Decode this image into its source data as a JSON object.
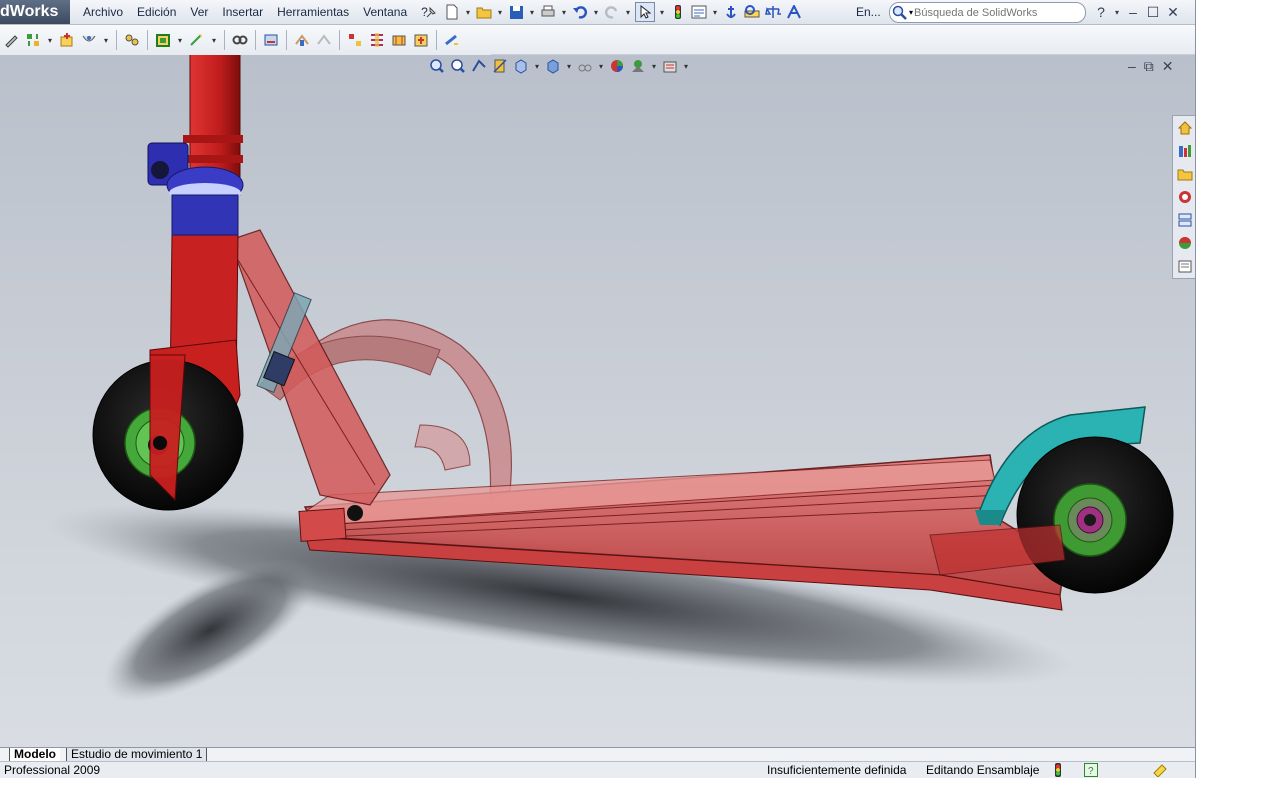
{
  "app": {
    "title_fragment": "dWorks"
  },
  "menu": {
    "items": [
      "Archivo",
      "Edición",
      "Ver",
      "Insertar",
      "Herramientas",
      "Ventana",
      "?"
    ]
  },
  "quick_access": {
    "overflow_label": "En..."
  },
  "search": {
    "placeholder": "Búsqueda de SolidWorks"
  },
  "window_controls": {
    "help": "?",
    "minimize": "–",
    "maximize": "☐",
    "close": "✕"
  },
  "tabs": [
    {
      "label": "Modelo",
      "active": true
    },
    {
      "label": "Estudio de movimiento 1",
      "active": false
    }
  ],
  "status": {
    "product": "Professional 2009",
    "definition": "Insuficientemente definida",
    "mode": "Editando Ensamblaje"
  },
  "colors": {
    "scooter_body": "#d43a3a",
    "scooter_stem": "#cc1f1f",
    "clamp": "#2d2fb0",
    "fender": "#2bb3b3",
    "wheel_tire": "#0d0d0d",
    "wheel_hub": "#3faa2c",
    "viewport_bg": "#c3c8d0"
  },
  "icons": {
    "toolbar": [
      "pencil-icon",
      "smart-mates-icon",
      "insert-component-icon",
      "mate-icon",
      "linear-pattern-icon",
      "move-component-icon",
      "hide-show-icon",
      "assembly-features-icon",
      "reference-geometry-icon",
      "new-motion-study-icon",
      "bill-of-materials-icon",
      "exploded-view-icon",
      "explode-line-icon",
      "interference-icon",
      "clearance-icon",
      "instant3d-icon"
    ],
    "heads_up": [
      "zoom-to-fit-icon",
      "zoom-area-icon",
      "previous-view-icon",
      "section-view-icon",
      "view-orientation-icon",
      "display-style-icon",
      "hide-show-items-icon",
      "appearance-icon",
      "scene-icon",
      "view-settings-icon"
    ],
    "task_pane": [
      "home-icon",
      "design-library-icon",
      "file-explorer-icon",
      "search-icon",
      "view-palette-icon",
      "appearances-icon",
      "custom-properties-icon"
    ]
  }
}
